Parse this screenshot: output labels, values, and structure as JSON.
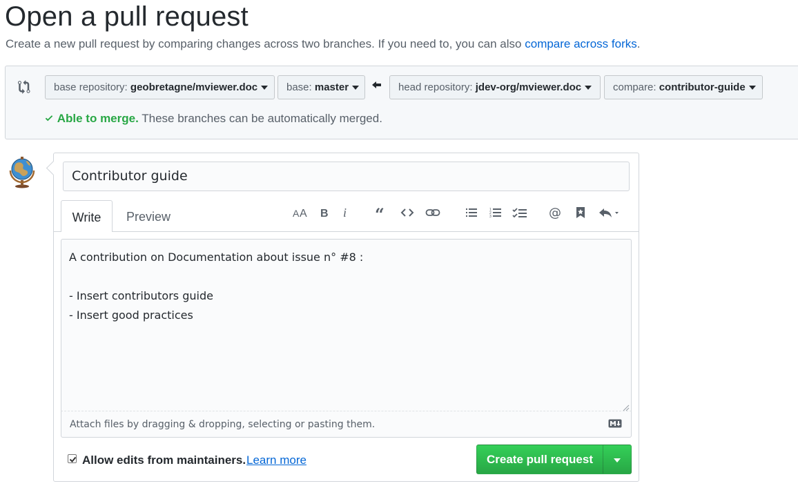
{
  "header": {
    "title": "Open a pull request",
    "subtitle": "Create a new pull request by comparing changes across two branches. If you need to, you can also",
    "compare_forks_link": "compare across forks",
    "subtitle_end": "."
  },
  "compare": {
    "base_repo_label": "base repository:",
    "base_repo_value": "geobretagne/mviewer.doc",
    "base_label": "base:",
    "base_value": "master",
    "head_repo_label": "head repository:",
    "head_repo_value": "jdev-org/mviewer.doc",
    "compare_label": "compare:",
    "compare_value": "contributor-guide",
    "merge_status_strong": "Able to merge.",
    "merge_status_text": "These branches can be automatically merged."
  },
  "form": {
    "title_value": "Contributor guide",
    "tabs": {
      "write": "Write",
      "preview": "Preview"
    },
    "body_value": "A contribution on Documentation about issue n° #8 :\n\n- Insert contributors guide\n- Insert good practices",
    "attach_text": "Attach files by dragging & dropping, selecting or pasting them.",
    "allow_edits_label": "Allow edits from maintainers.",
    "allow_edits_checked": true,
    "learn_more_link": "Learn more",
    "submit_label": "Create pull request"
  },
  "toolbar": {
    "items": [
      "header-icon",
      "bold-icon",
      "italic-icon",
      "quote-icon",
      "code-icon",
      "link-icon",
      "bulleted-list-icon",
      "numbered-list-icon",
      "task-list-icon",
      "mention-icon",
      "saved-reply-icon",
      "reply-icon"
    ]
  },
  "colors": {
    "accent_link": "#0366d6",
    "success_green": "#28a745",
    "button_green": "#2cbe4e"
  }
}
